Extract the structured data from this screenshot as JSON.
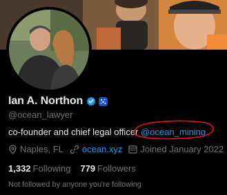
{
  "profile": {
    "name": "Ian A. Northon",
    "handle": "@ocean_lawyer",
    "bio_text": "co-founder and chief legal officer ",
    "bio_mention": "@ocean_mining",
    "location": "Naples, FL",
    "website": "ocean.xyz",
    "joined": "Joined January 2022",
    "following_count": "1,332",
    "following_label": "Following",
    "followers_count": "779",
    "followers_label": "Followers",
    "followed_by_note": "Not followed by anyone you're following"
  },
  "icons": {
    "verified": "verified-badge-icon",
    "affiliation": "affiliate-badge-icon",
    "location": "location-pin-icon",
    "link": "link-icon",
    "calendar": "calendar-icon"
  },
  "colors": {
    "background": "#000000",
    "text_primary": "#e7e9ea",
    "text_secondary": "#71767b",
    "link": "#1d9bf0",
    "verified": "#1d9bf0",
    "annotation": "#e8141c"
  }
}
